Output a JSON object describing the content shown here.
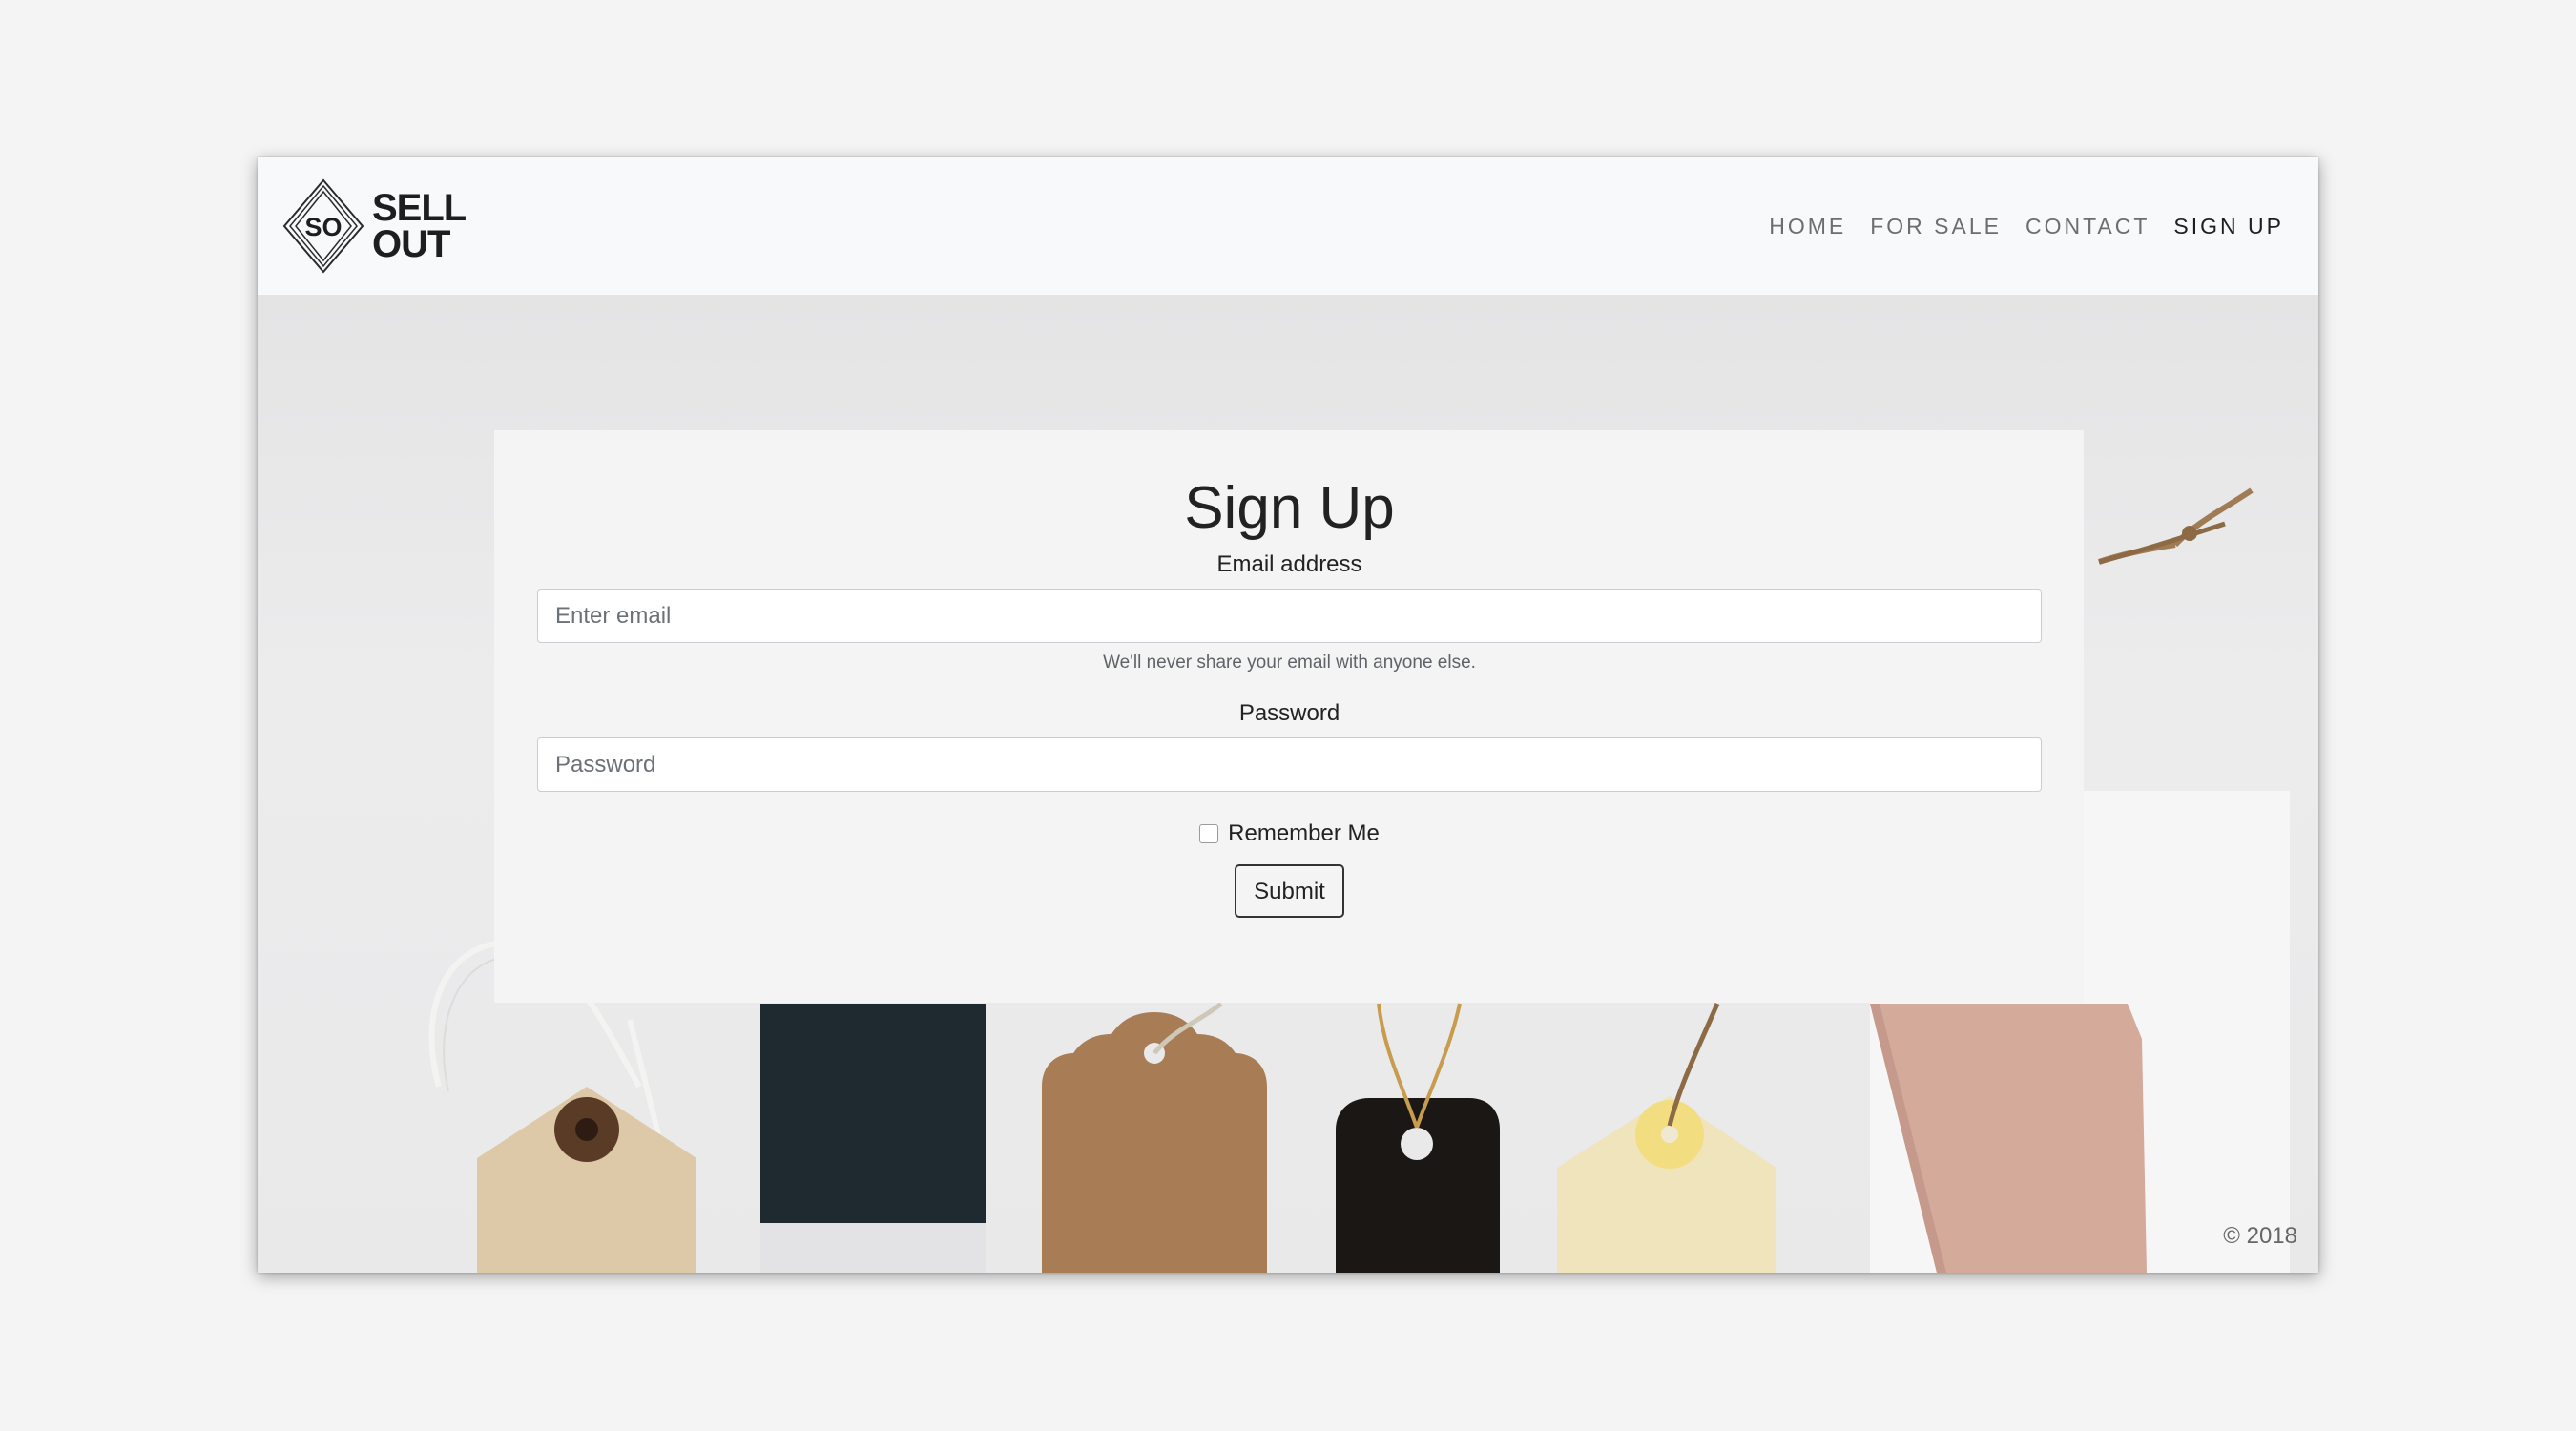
{
  "brand": {
    "monogram": "SO",
    "line1": "SELL",
    "line2": "OUT"
  },
  "nav": {
    "items": [
      {
        "label": "HOME",
        "active": false
      },
      {
        "label": "FOR SALE",
        "active": false
      },
      {
        "label": "CONTACT",
        "active": false
      },
      {
        "label": "SIGN UP",
        "active": true
      }
    ]
  },
  "form": {
    "title": "Sign Up",
    "email_label": "Email address",
    "email_placeholder": "Enter email",
    "email_value": "",
    "email_help": "We'll never share your email with anyone else.",
    "password_label": "Password",
    "password_placeholder": "Password",
    "password_value": "",
    "remember_label": "Remember Me",
    "remember_checked": false,
    "submit_label": "Submit"
  },
  "footer": {
    "copyright": "© 2018"
  },
  "colors": {
    "navbar_bg": "#f8f9fa",
    "card_bg": "#f4f4f4",
    "text_dark": "#222222",
    "nav_muted": "#6d6d6d"
  },
  "background_image": {
    "tag-colors": [
      "#ddc9a8",
      "#1f2a30",
      "#a87c55",
      "#1a1715",
      "#efe4bc",
      "#d4aa9b"
    ]
  }
}
